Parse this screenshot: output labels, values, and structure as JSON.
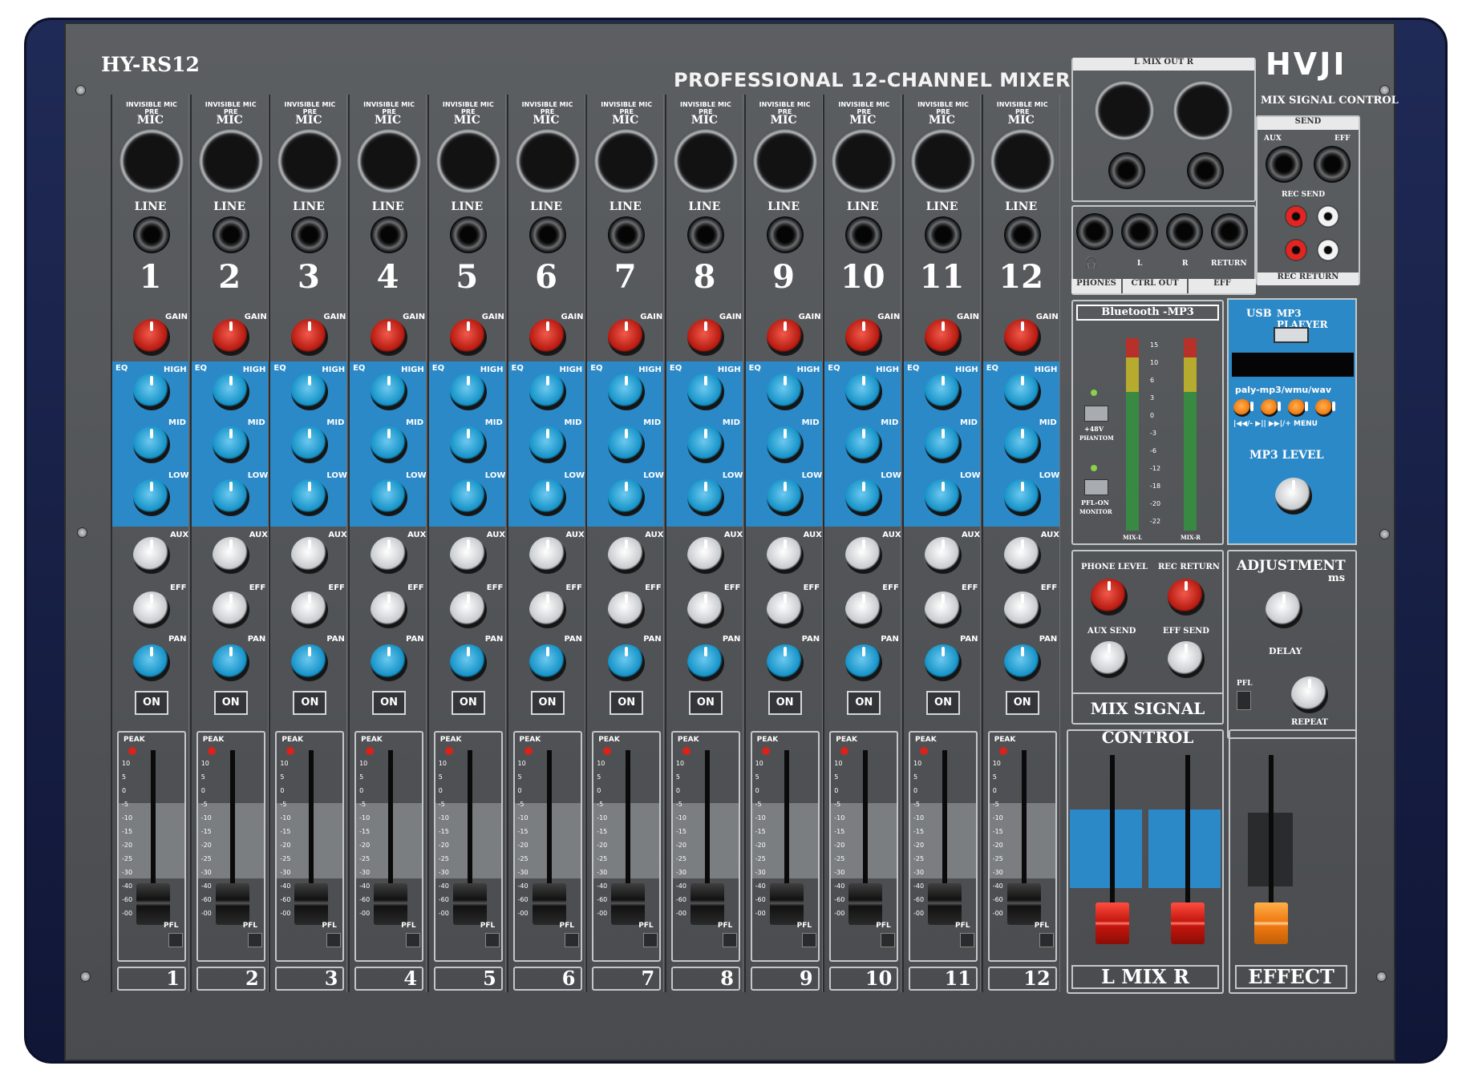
{
  "device": {
    "model": "HY-RS12",
    "title": "PROFESSIONAL 12-CHANNEL MIXER",
    "brand": "HVJI",
    "brand_sub": "MIX SIGNAL CONTROL"
  },
  "channel_labels": {
    "mic_pre": "INVISIBLE MIC PRE",
    "mic": "MIC",
    "line": "LINE",
    "gain": "GAIN",
    "eq": "EQ",
    "high": "HIGH",
    "mid": "MID",
    "low": "LOW",
    "aux": "AUX",
    "eff": "EFF",
    "pan": "PAN",
    "on": "ON",
    "peak": "PEAK",
    "pfl": "PFL"
  },
  "channels": [
    {
      "number": "1"
    },
    {
      "number": "2"
    },
    {
      "number": "3"
    },
    {
      "number": "4"
    },
    {
      "number": "5"
    },
    {
      "number": "6"
    },
    {
      "number": "7"
    },
    {
      "number": "8"
    },
    {
      "number": "9"
    },
    {
      "number": "10"
    },
    {
      "number": "11"
    },
    {
      "number": "12"
    }
  ],
  "fader_scale": [
    "10",
    "5",
    "0",
    "-5",
    "-10",
    "-15",
    "-20",
    "-25",
    "-30",
    "-40",
    "-60",
    "-00"
  ],
  "io": {
    "mix_out": "L   MIX OUT   R",
    "send": "SEND",
    "aux": "AUX",
    "eff": "EFF",
    "rec_send": "REC SEND",
    "l": "L",
    "r": "R",
    "return": "RETURN",
    "phones": "PHONES",
    "ctrl_out": "CTRL OUT",
    "eff_section": "EFF",
    "rec_return": "REC RETURN"
  },
  "master": {
    "bluetooth": "Bluetooth -MP3",
    "phantom": "+48V",
    "phantom_sub": "PHANTOM",
    "pfl_on": "PFL-ON",
    "monitor": "MONITOR",
    "meter_scale": [
      "15",
      "10",
      "6",
      "3",
      "0",
      "-3",
      "-6",
      "-12",
      "-18",
      "-20",
      "-22"
    ],
    "mix_l": "MIX-L",
    "mix_r": "MIX-R",
    "phone_level": "PHONE LEVEL",
    "rec_return": "REC RETURN",
    "aux_send": "AUX SEND",
    "eff_send": "EFF SEND",
    "mix_signal_control": "MIX SIGNAL CONTROL",
    "mix_label": "L   MIX   R"
  },
  "mp3": {
    "usb": "USB",
    "player": "MP3 PLAEYER",
    "formats": "paly-mp3/wmu/wav",
    "controls": "|◀◀/-  ▶||  ▶▶|/+  MENU",
    "level": "MP3 LEVEL",
    "adjustment": "ADJUSTMENT",
    "ms": "ms",
    "delay": "DELAY",
    "pfl": "PFL",
    "repeat": "REPEAT",
    "effect": "EFFECT"
  },
  "colors": {
    "panel": "#515457",
    "eq_band": "#2c89c8",
    "gain_knob": "#c3160d",
    "master_fader": "#c3160d",
    "effect_fader": "#f07a12",
    "chassis": "#1f2a56"
  }
}
